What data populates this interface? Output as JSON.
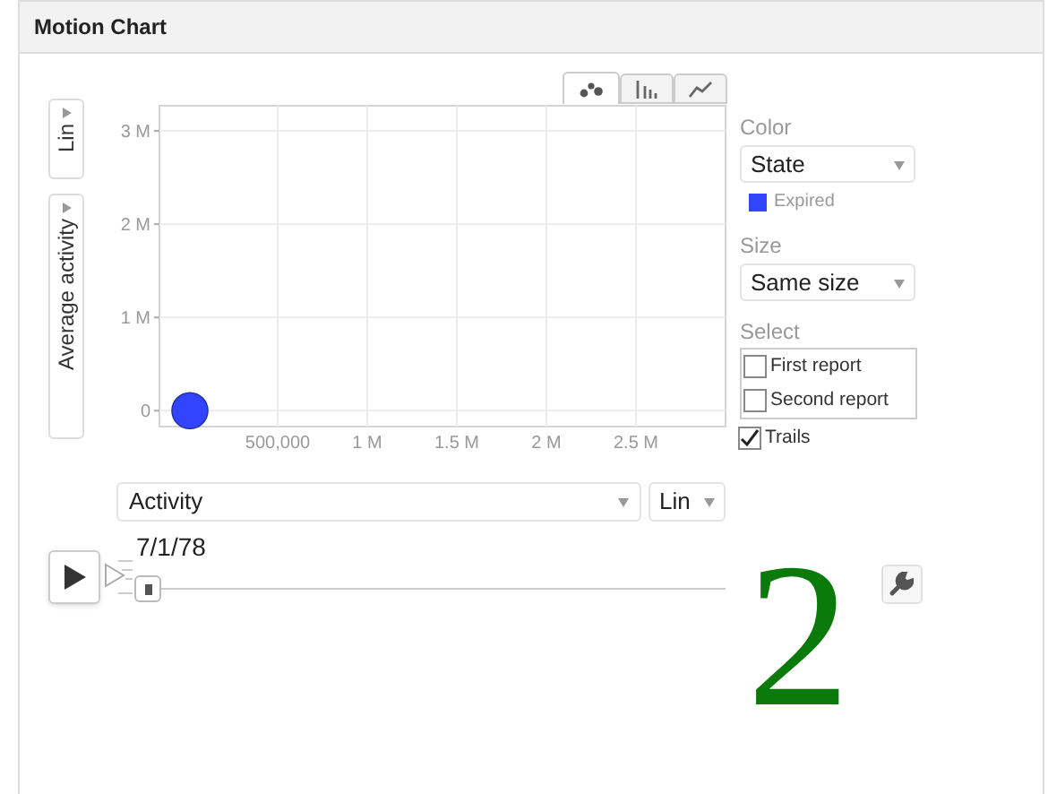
{
  "panel": {
    "title": "Motion Chart"
  },
  "y_scale": {
    "label": "Lin"
  },
  "y_axis": {
    "label": "Average activity"
  },
  "chart_tabs": [
    {
      "kind": "bubble",
      "selected": true
    },
    {
      "kind": "bar",
      "selected": false
    },
    {
      "kind": "line",
      "selected": false
    }
  ],
  "chart_data": {
    "type": "scatter",
    "x": [
      10000
    ],
    "series": [
      {
        "name": "Expired",
        "color": "#3344ff",
        "values": [
          0
        ]
      }
    ],
    "grid": true,
    "xlim": [
      -160000,
      3000000
    ],
    "ylim": [
      -170000,
      3270000
    ],
    "xticks": [
      {
        "value": 500000,
        "label": "500,000"
      },
      {
        "value": 1000000,
        "label": "1 M"
      },
      {
        "value": 1500000,
        "label": "1.5 M"
      },
      {
        "value": 2000000,
        "label": "2 M"
      },
      {
        "value": 2500000,
        "label": "2.5 M"
      }
    ],
    "yticks": [
      {
        "value": 0,
        "label": "0"
      },
      {
        "value": 1000000,
        "label": "1 M"
      },
      {
        "value": 2000000,
        "label": "2 M"
      },
      {
        "value": 3000000,
        "label": "3 M"
      }
    ]
  },
  "side": {
    "color_label": "Color",
    "color_value": "State",
    "size_label": "Size",
    "size_value": "Same size",
    "select_label": "Select",
    "select_items": [
      {
        "label": "First report",
        "checked": false
      },
      {
        "label": "Second report",
        "checked": false
      }
    ],
    "trails": {
      "label": "Trails",
      "checked": true
    }
  },
  "x_axis": {
    "label": "Activity"
  },
  "x_scale": {
    "label": "Lin"
  },
  "slider": {
    "date": "7/1/78"
  },
  "overlay_number": "2"
}
